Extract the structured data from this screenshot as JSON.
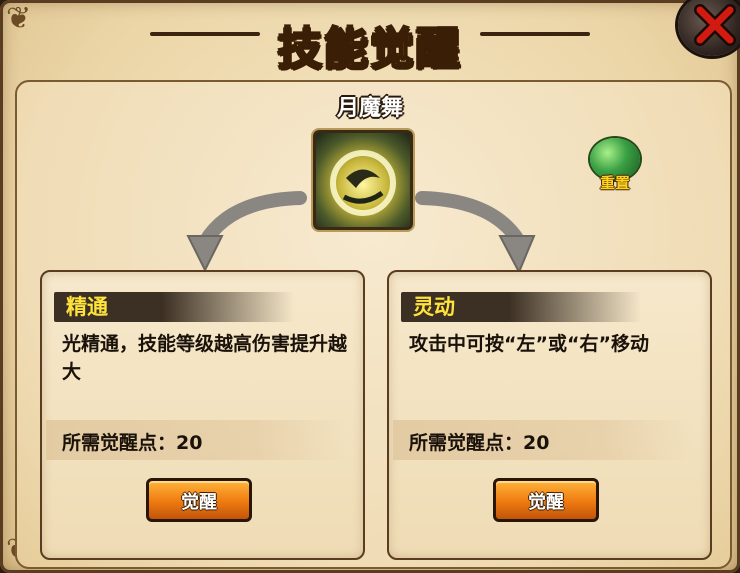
{
  "window": {
    "title": "技能觉醒"
  },
  "skill": {
    "name": "月魔舞"
  },
  "reset": {
    "label": "重置"
  },
  "options": [
    {
      "name": "精通",
      "description": "光精通，技能等级越高伤害提升越大",
      "cost_label": "所需觉醒点：",
      "cost_value": "20",
      "button_label": "觉醒"
    },
    {
      "name": "灵动",
      "description": "攻击中可按“左”或“右”移动",
      "cost_label": "所需觉醒点：",
      "cost_value": "20",
      "button_label": "觉醒"
    }
  ],
  "colors": {
    "title": "#ffd21c",
    "header_text": "#ffe23a",
    "button": "#ee7a10",
    "close_mark": "#d21a10"
  },
  "icons": {
    "close": "close-icon",
    "skill": "crescent-dance-skill-icon",
    "reset": "green-orb-icon"
  }
}
